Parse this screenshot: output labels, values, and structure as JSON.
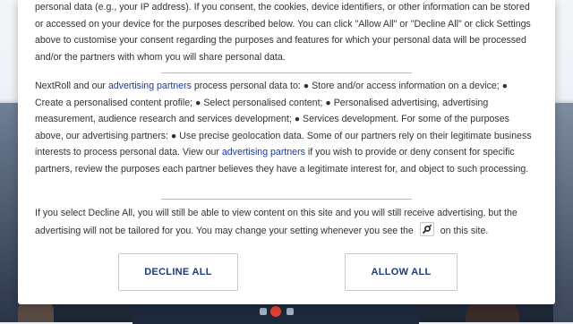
{
  "consent": {
    "intro": {
      "text": "personal data (e.g., your IP address). If you consent, the cookies, device identifiers, or other information can be stored or accessed on your device for the purposes described below. You can click \"Allow All\" or \"Decline All\" or click Settings above to customise your consent regarding the purposes and features for which your personal data will be processed and/or the partners with whom you will share personal data."
    },
    "processing": {
      "part1": "NextRoll and our ",
      "link1": "advertising partners",
      "part2": " process personal data to: ● Store and/or access information on a device; ● Create a personalised content profile; ● Select personalised content; ● Personalised advertising, advertising measurement, audience research and services development; ● Services development. For some of the purposes above, our advertising partners: ● Use precise geolocation data. Some of our partners rely on their legitimate business interests to process personal data. View our ",
      "link2": "advertising partners",
      "part3": " if you wish to provide or deny consent for specific partners, review the purposes each partner believes they have a legitimate interest for, and object to such processing."
    },
    "decline_note": {
      "part1": "If you select Decline All, you will still be able to view content on this site and you will still receive advertising, but the advertising will not be tailored for you. You may change your setting whenever you see the ",
      "icon": "settings-toggle-icon",
      "part2": " on this site."
    },
    "buttons": {
      "decline_label": "DECLINE ALL",
      "allow_label": "ALLOW ALL"
    },
    "colors": {
      "link": "#1a3a9c",
      "button_text": "#1e3a78",
      "body_text": "#333333"
    }
  }
}
